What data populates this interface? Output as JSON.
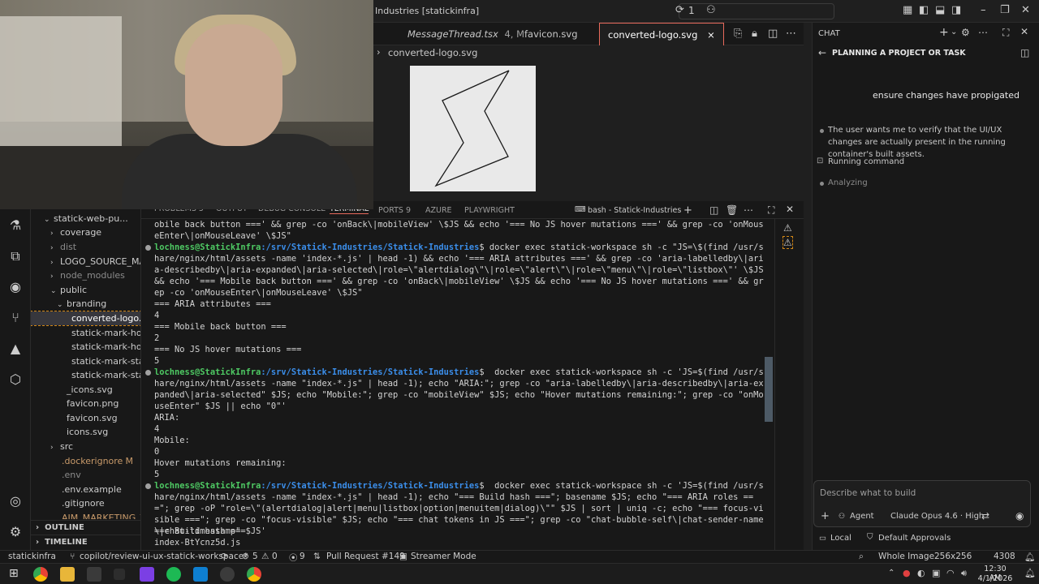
{
  "window": {
    "title": "Industries [statickinfra]",
    "notif_count": "1"
  },
  "editor": {
    "tabs": [
      {
        "label": "MessageThread.tsx",
        "suffix": "4, M"
      },
      {
        "label": "favicon.svg"
      },
      {
        "label": "converted-logo.svg",
        "close": "×"
      }
    ],
    "breadcrumb": "converted-logo.svg"
  },
  "explorer": {
    "items": [
      {
        "label": "statick-web-pu...",
        "chev": "⌄"
      },
      {
        "label": "coverage",
        "chev": "›"
      },
      {
        "label": "dist",
        "chev": "›"
      },
      {
        "label": "LOGO_SOURCE_MA...",
        "chev": "›"
      },
      {
        "label": "node_modules",
        "chev": "›"
      },
      {
        "label": "public",
        "chev": "⌄"
      },
      {
        "label": "branding",
        "chev": "⌄"
      },
      {
        "label": "converted-logo.s..."
      },
      {
        "label": "statick-mark-hov..."
      },
      {
        "label": "statick-mark-hov..."
      },
      {
        "label": "statick-mark-stat..."
      },
      {
        "label": "statick-mark-stat..."
      },
      {
        "label": "_icons.svg"
      },
      {
        "label": "favicon.png"
      },
      {
        "label": "favicon.svg"
      },
      {
        "label": "icons.svg"
      },
      {
        "label": "src",
        "chev": "›"
      },
      {
        "label": ".dockerignore",
        "badge": "M"
      },
      {
        "label": ".env"
      },
      {
        "label": ".env.example"
      },
      {
        "label": ".gitignore"
      },
      {
        "label": "AIM_MARKETING_T..."
      }
    ],
    "outline": "OUTLINE",
    "timeline": "TIMELINE"
  },
  "panel": {
    "tabs": [
      "PROBLEMS 5",
      "OUTPUT",
      "DEBUG CONSOLE",
      "TERMINAL",
      "PORTS 9",
      "AZURE",
      "PLAYWRIGHT"
    ],
    "terminal_name": "bash - Statick-Industries"
  },
  "terminal": {
    "user": "lochness@StatickInfra",
    "path": ":/srv/Statick-Industries/Statick-Industries",
    "prefix_line": "obile back button ===' && grep -co 'onBack\\|mobileView' \\$JS && echo '=== No JS hover mutations ===' && grep -co 'onMouseEnter\\|onMouseLeave' \\$JS\"",
    "cmd1": "$ docker exec statick-workspace sh -c \"JS=\\$(find /usr/share/nginx/html/assets -name 'index-*.js' | head -1) && echo '=== ARIA attributes ===' && grep -co 'aria-labelledby\\|aria-describedby\\|aria-expanded\\|aria-selected\\|role=\\\"alertdialog\\\"\\|role=\\\"alert\\\"\\|role=\\\"menu\\\"\\|role=\\\"listbox\\\"' \\$JS && echo '=== Mobile back button ===' && grep -co 'onBack\\|mobileView' \\$JS && echo '=== No JS hover mutations ===' && grep -co 'onMouseEnter\\|onMouseLeave' \\$JS\"",
    "out1": [
      "=== ARIA attributes ===",
      "4",
      "=== Mobile back button ===",
      "2",
      "=== No JS hover mutations ===",
      "5"
    ],
    "cmd2": "$  docker exec statick-workspace sh -c 'JS=$(find /usr/share/nginx/html/assets -name \"index-*.js\" | head -1); echo \"ARIA:\"; grep -co \"aria-labelledby\\|aria-describedby\\|aria-expanded\\|aria-selected\" $JS; echo \"Mobile:\"; grep -co \"mobileView\" $JS; echo \"Hover mutations remaining:\"; grep -co \"onMouseEnter\" $JS || echo \"0\"'",
    "out2": [
      "ARIA:",
      "4",
      "Mobile:",
      "0",
      "Hover mutations remaining:",
      "5"
    ],
    "cmd3": "$  docker exec statick-workspace sh -c 'JS=$(find /usr/share/nginx/html/assets -name \"index-*.js\" | head -1); echo \"=== Build hash ===\"; basename $JS; echo \"=== ARIA roles ===\"; grep -oP \"role=\\\"(alertdialog|alert|menu|listbox|option|menuitem|dialog)\\\"\" $JS | sort | uniq -c; echo \"=== focus-visible ===\"; grep -co \"focus-visible\" $JS; echo \"=== chat tokens in JS ===\"; grep -co \"chat-bubble-self\\|chat-sender-name\\|chat-timestamp\" $JS'",
    "out3": [
      "=== Build hash ===",
      "index-BtYcnz5d.js"
    ]
  },
  "chat": {
    "header": "CHAT",
    "title": "PLANNING A PROJECT OR TASK",
    "user_message": "ensure changes have propigated",
    "steps": [
      "The user wants me to verify that the UI/UX changes are actually present in the running container's built assets.",
      "Running command",
      "Analyzing"
    ],
    "input_placeholder": "Describe what to build",
    "mode": "Agent",
    "model": "Claude Opus 4.6 · High",
    "location": "Local",
    "approvals": "Default Approvals"
  },
  "status": {
    "remote": "statickinfra",
    "branch": "copilot/review-ui-ux-statick-workspace*",
    "errors": "5",
    "warnings": "0",
    "ports": "9",
    "pr": "Pull Request #149",
    "mode": "Streamer Mode",
    "zoom": "Whole Image",
    "dims": "256x256",
    "num": "4308"
  },
  "taskbar": {
    "time": "12:30 AM",
    "date": "4/1/2026"
  },
  "colors": {
    "accent": "#e86a5c",
    "user": "#4ec963",
    "path": "#3b8eea"
  }
}
